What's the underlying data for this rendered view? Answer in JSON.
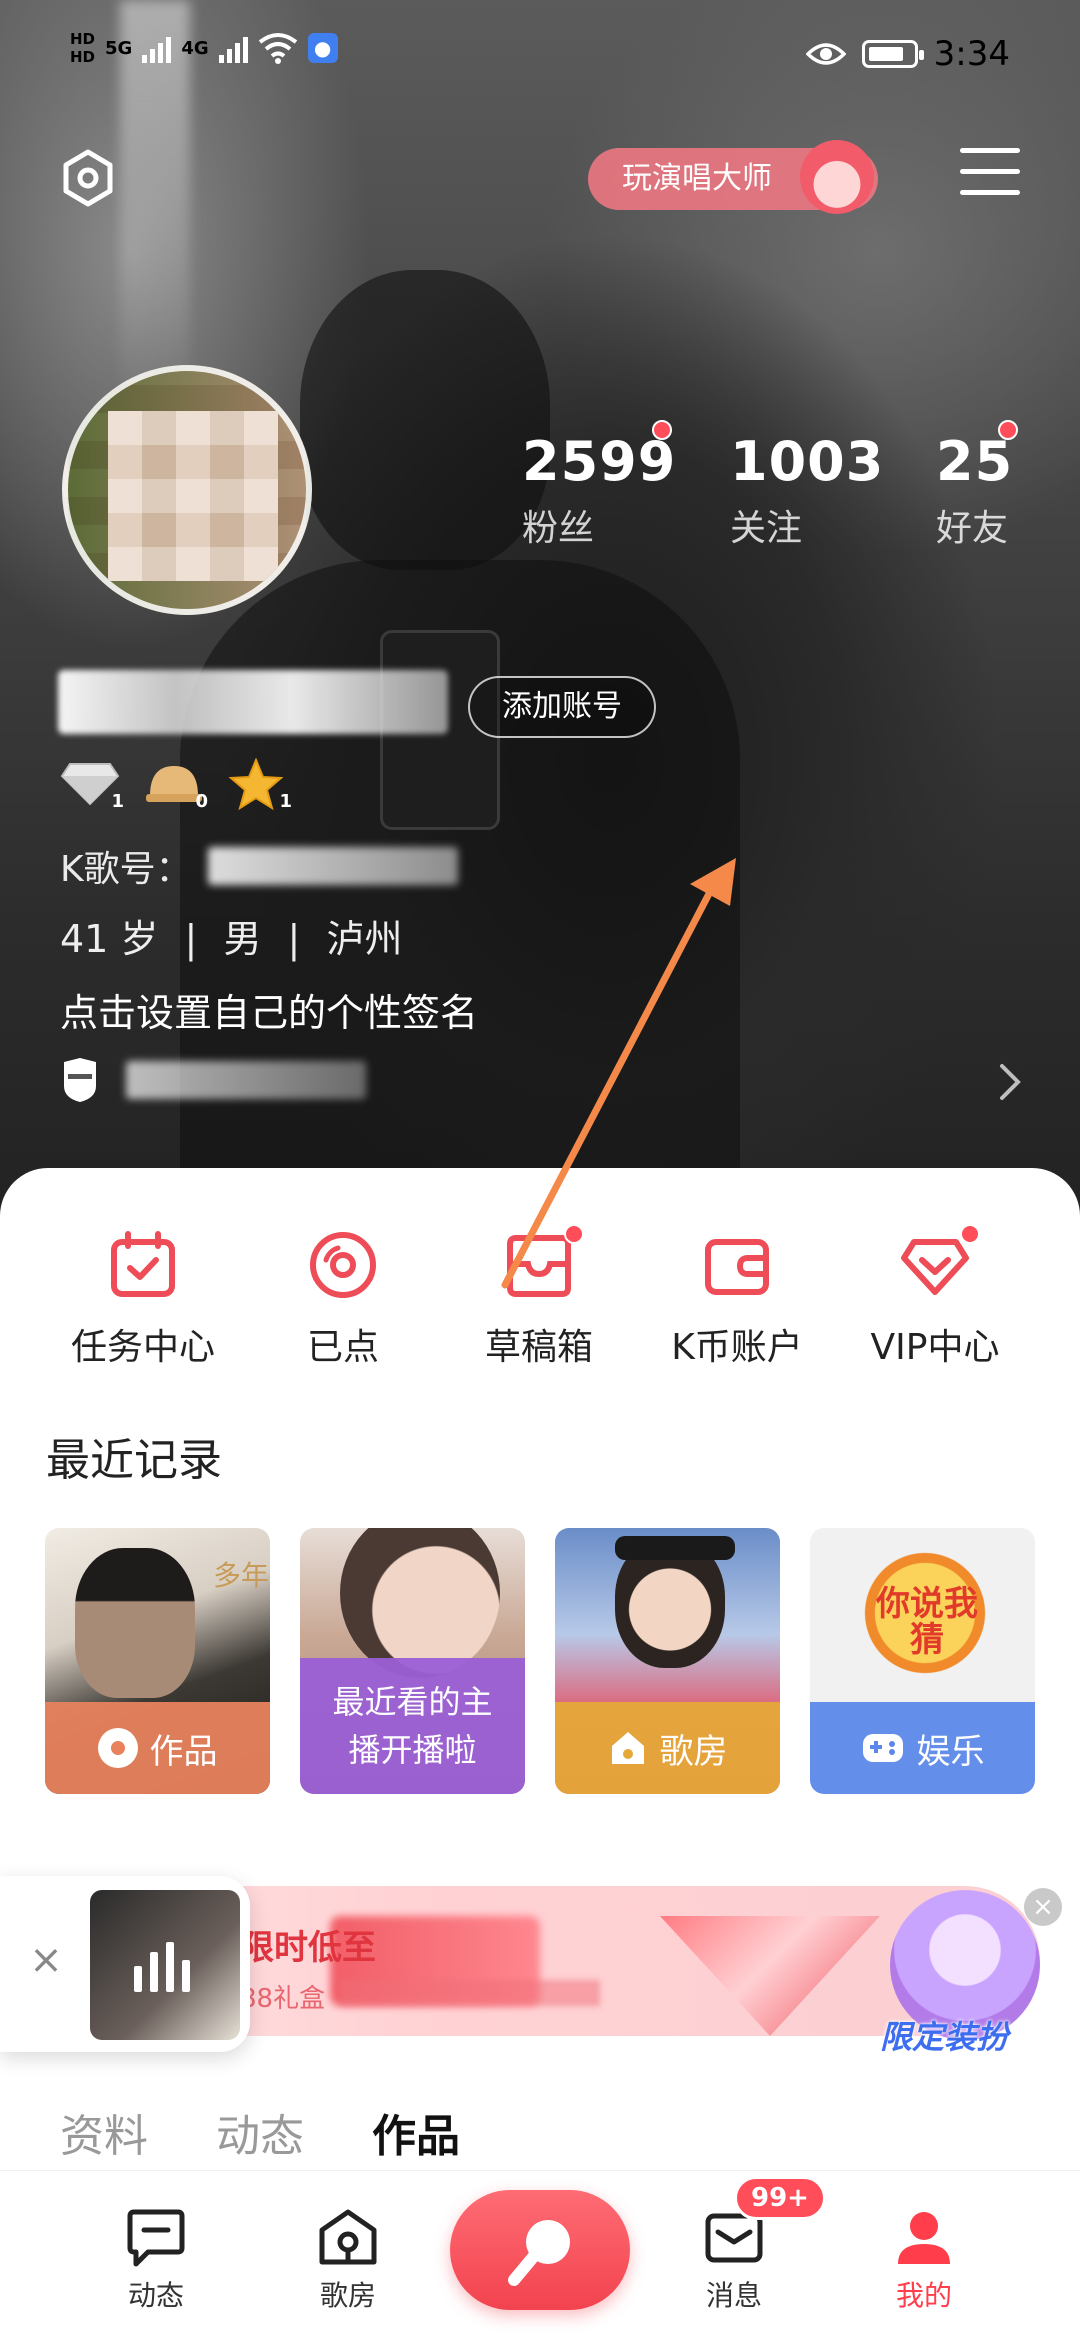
{
  "status_bar": {
    "hd1": "HD",
    "hd2": "HD",
    "net1": "5G",
    "net2": "4G",
    "time": "3:34"
  },
  "header": {
    "promo_label": "玩演唱大师",
    "add_account": "添加账号"
  },
  "stats": [
    {
      "value": "2599",
      "label": "粉丝",
      "dot": true
    },
    {
      "value": "1003",
      "label": "关注",
      "dot": false
    },
    {
      "value": "25",
      "label": "好友",
      "dot": true
    }
  ],
  "badges": [
    {
      "icon": "diamond-icon",
      "count": "1"
    },
    {
      "icon": "crown-icon",
      "count": "0"
    },
    {
      "icon": "star-icon",
      "count": "1"
    }
  ],
  "profile": {
    "k_id_label": "K歌号：",
    "age": "41 岁",
    "gender": "男",
    "city": "泸州",
    "separator": "|",
    "signature": "点击设置自己的个性签名"
  },
  "quick_actions": [
    {
      "label": "任务中心",
      "icon": "calendar-check-icon",
      "dot": false
    },
    {
      "label": "已点",
      "icon": "disc-icon",
      "dot": false
    },
    {
      "label": "草稿箱",
      "icon": "drafts-box-icon",
      "dot": true
    },
    {
      "label": "K币账户",
      "icon": "wallet-icon",
      "dot": false
    },
    {
      "label": "VIP中心",
      "icon": "vip-diamond-icon",
      "dot": true
    }
  ],
  "recent": {
    "title": "最近记录",
    "cards": [
      {
        "label": "作品",
        "icon": "disc-icon",
        "color": "#e8825d"
      },
      {
        "label": "最近看的主播开播啦",
        "icon": "",
        "color": "#9b5fd6"
      },
      {
        "label": "歌房",
        "icon": "house-icon",
        "color": "#e5a93a"
      },
      {
        "label": "娱乐",
        "icon": "gamepad-icon",
        "color": "#5b88e8"
      }
    ],
    "card1_art_text": "多年",
    "card4_art_text": "你说我猜"
  },
  "banner": {
    "text_visible": "限时低至",
    "sub_visible": "88礼盒",
    "badge": "限定装扮"
  },
  "tabs": [
    {
      "label": "资料",
      "active": false
    },
    {
      "label": "动态",
      "active": false
    },
    {
      "label": "作品",
      "active": true
    }
  ],
  "bottom_nav": [
    {
      "label": "动态",
      "icon": "feed-icon",
      "active": false
    },
    {
      "label": "歌房",
      "icon": "room-icon",
      "active": false
    },
    {
      "label": "",
      "icon": "mic-icon",
      "active": false
    },
    {
      "label": "消息",
      "icon": "mail-icon",
      "active": false
    },
    {
      "label": "我的",
      "icon": "person-icon",
      "active": true
    }
  ],
  "message_badge": "99+",
  "colors": {
    "accent": "#ff4d5a",
    "quick_icon": "#ee4d57",
    "annotation_arrow": "#f5894a"
  }
}
